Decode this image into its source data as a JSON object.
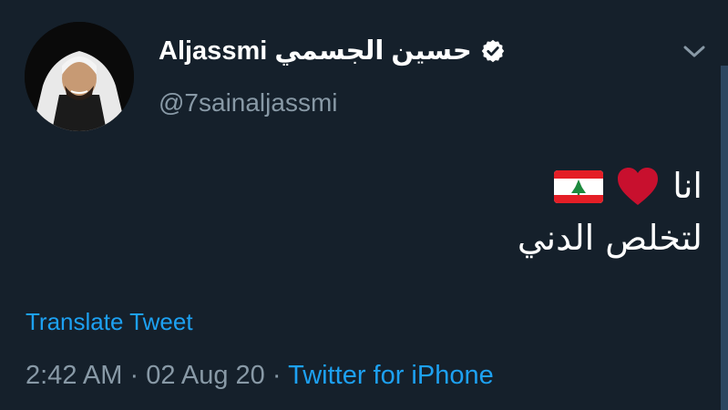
{
  "user": {
    "display_name": "Aljassmi حسين الجسمي",
    "handle": "@7sainaljassmi",
    "verified_icon": "verified-badge-icon",
    "avatar_icon": "avatar"
  },
  "tweet": {
    "line1_text": "انا",
    "line1_icons": [
      "heart-icon",
      "lebanon-flag-icon"
    ],
    "line2_text": "لتخلص الدني"
  },
  "translate_label": "Translate Tweet",
  "meta": {
    "time": "2:42 AM",
    "sep1": " · ",
    "date": "02 Aug 20",
    "sep2": " · ",
    "source": "Twitter for iPhone"
  },
  "colors": {
    "background": "#15202b",
    "link": "#1da1f2",
    "secondary_text": "#8899a6",
    "heart": "#c8102e"
  }
}
